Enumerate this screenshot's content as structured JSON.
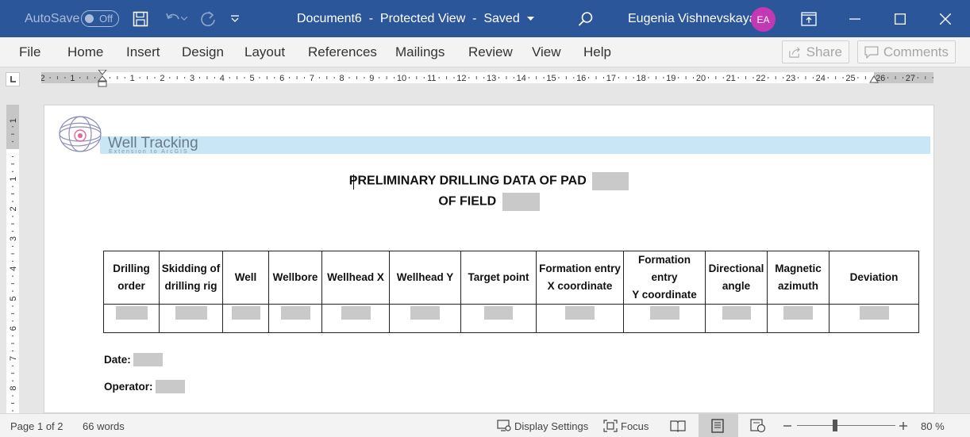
{
  "titlebar": {
    "autosave_label": "AutoSave",
    "autosave_state": "Off",
    "doc_title": "Document6  -  Protected View  -  Saved",
    "user_name": "Eugenia Vishnevskaya",
    "avatar_initials": "EA"
  },
  "ribbon": {
    "tabs": [
      "File",
      "Home",
      "Insert",
      "Design",
      "Layout",
      "References",
      "Mailings",
      "Review",
      "View",
      "Help"
    ],
    "share_label": "Share",
    "comments_label": "Comments"
  },
  "ruler": {
    "h_ticks": [
      "2",
      "1",
      "1",
      "2",
      "3",
      "4",
      "5",
      "6",
      "7",
      "8",
      "9",
      "10",
      "11",
      "12",
      "13",
      "14",
      "15",
      "16",
      "17",
      "18",
      "19",
      "20",
      "21",
      "22",
      "23",
      "24",
      "25",
      "26",
      "27"
    ],
    "v_ticks": [
      "1",
      "1",
      "2",
      "3",
      "4",
      "5",
      "6",
      "7",
      "8"
    ]
  },
  "document": {
    "logo_text": "Well Tracking",
    "logo_subtext": "Extension to ArcGIS",
    "heading_line1": "PRELIMINARY DRILLING DATA OF PAD",
    "heading_line2": "OF FIELD",
    "table_headers": [
      [
        "Drilling",
        "order"
      ],
      [
        "Skidding of",
        "drilling rig"
      ],
      [
        "Well"
      ],
      [
        "Wellbore"
      ],
      [
        "Wellhead X"
      ],
      [
        "Wellhead Y"
      ],
      [
        "Target point"
      ],
      [
        "Formation entry",
        "X coordinate"
      ],
      [
        "Formation entry",
        "Y coordinate"
      ],
      [
        "Directional",
        "angle"
      ],
      [
        "Magnetic",
        "azimuth"
      ],
      [
        "Deviation"
      ]
    ],
    "date_label": "Date:",
    "operator_label": "Operator:"
  },
  "statusbar": {
    "page_info": "Page 1 of 2",
    "word_count": "66 words",
    "display_settings": "Display Settings",
    "focus": "Focus",
    "zoom_level": "80 %"
  },
  "colors": {
    "titlebar": "#2b579a",
    "avatar": "#c239b3",
    "header_band": "#c9e6f7",
    "placeholder": "#c9c9c9"
  }
}
